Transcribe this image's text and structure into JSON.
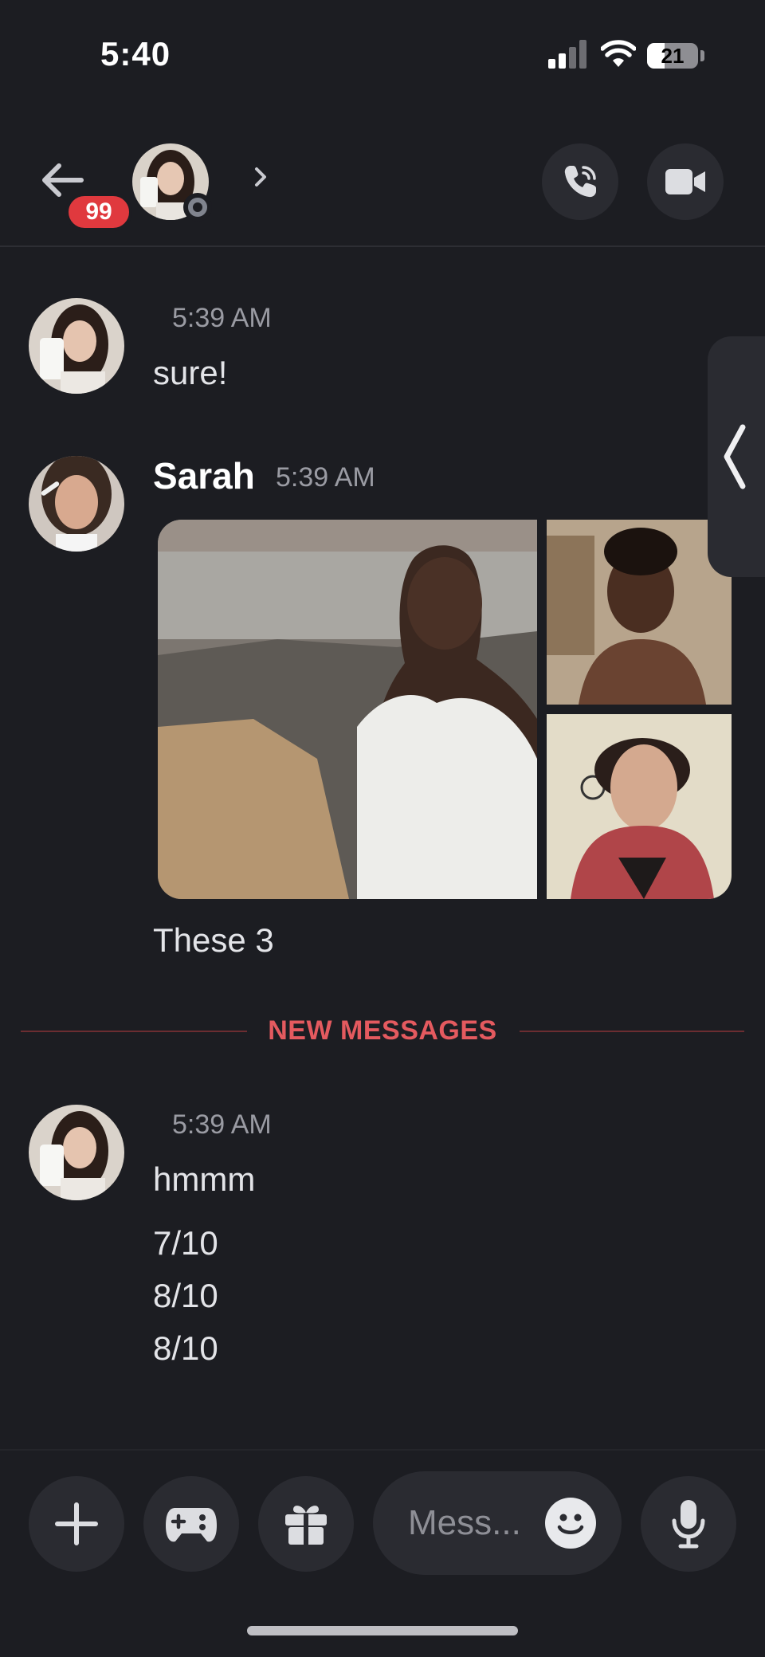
{
  "status_bar": {
    "time": "5:40",
    "battery": "21"
  },
  "header": {
    "unread_badge": "99",
    "back_icon": "arrow-left-icon",
    "chevron_icon": "chevron-right-icon",
    "call_icon": "phone-icon",
    "video_icon": "video-camera-icon"
  },
  "messages": [
    {
      "time": "5:39 AM",
      "text": "sure!"
    },
    {
      "author": "Sarah",
      "time": "5:39 AM",
      "caption": "These 3",
      "attachments": [
        "photo-1",
        "photo-2",
        "photo-3"
      ]
    },
    {
      "time": "5:39 AM",
      "text": "hmmm",
      "lines": [
        "7/10",
        "8/10",
        "8/10"
      ]
    }
  ],
  "divider": {
    "label": "NEW MESSAGES"
  },
  "composer": {
    "placeholder": "Mess...",
    "icons": [
      "plus-icon",
      "gamepad-icon",
      "gift-icon",
      "smiley-icon",
      "microphone-icon"
    ]
  },
  "colors": {
    "background": "#1c1d22",
    "badge_red": "#e0393e",
    "new_messages_red": "#e45a5f"
  }
}
